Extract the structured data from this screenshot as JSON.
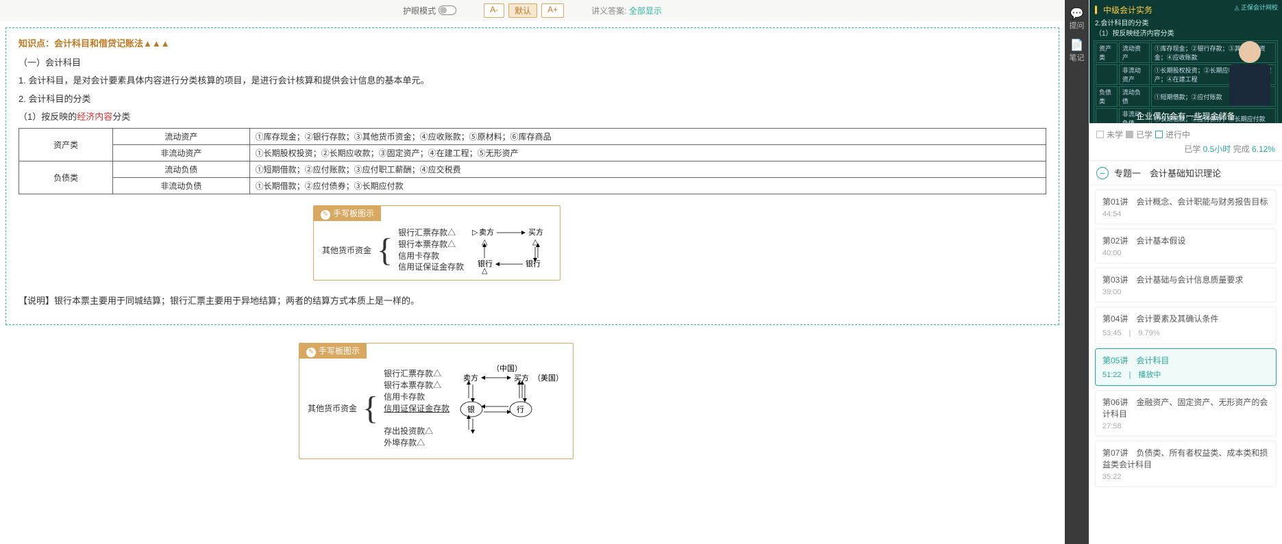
{
  "toolbar": {
    "eye_label": "护眼模式",
    "font_minus": "A-",
    "font_default": "默认",
    "font_plus": "A+",
    "ans_label": "讲义答案:",
    "ans_value": "全部显示"
  },
  "vside": {
    "ask": "提问",
    "note": "笔记"
  },
  "doc": {
    "kp_title": "知识点：会计科目和借贷记账法▲▲▲",
    "h_a": "（一）会计科目",
    "l1": "1. 会计科目，是对会计要素具体内容进行分类核算的项目，是进行会计核算和提供会计信息的基本单元。",
    "l2": "2. 会计科目的分类",
    "l3_pre": "（1）按反映的",
    "l3_red": "经济内容",
    "l3_post": "分类",
    "table": {
      "r1c1": "资产类",
      "r1c2": "流动资产",
      "r1c3": "①库存现金；②银行存款；③其他货币资金；④应收账款；⑤原材料；⑥库存商品",
      "r2c2": "非流动资产",
      "r2c3": "①长期股权投资；②长期应收款；③固定资产；④在建工程；⑤无形资产",
      "r3c1": "负债类",
      "r3c2": "流动负债",
      "r3c3": "①短期借款；②应付账款；③应付职工薪酬；④应交税费",
      "r4c2": "非流动负债",
      "r4c3": "①长期借款；②应付债券；③长期应付款"
    },
    "hw_title": "手写板图示",
    "hw1": {
      "label": "其他货币资金",
      "items": [
        "银行汇票存款△",
        "银行本票存款△",
        "信用卡存款",
        "信用证保证金存款"
      ],
      "flow": {
        "seller": "卖方",
        "buyer": "买方",
        "bank1": "银行",
        "bank2": "银行",
        "tri": "△"
      }
    },
    "note": "【说明】银行本票主要用于同城结算；银行汇票主要用于异地结算；两者的结算方式本质上是一样的。",
    "hw2": {
      "label": "其他货币资金",
      "items": [
        "银行汇票存款△",
        "银行本票存款△",
        "信用卡存款",
        "信用证保证金存款",
        "",
        "存出投资款△",
        "外埠存款△"
      ],
      "flow": {
        "cn": "（中国）",
        "us": "（美国）",
        "seller": "卖方",
        "buyer": "买方",
        "bank_l": "银",
        "bank_r": "行"
      },
      "underline_idx": 3
    }
  },
  "video": {
    "logo": "◬ 正保会计网校",
    "course": "▎中级会计实务",
    "sub1": "2.会计科目的分类",
    "sub2": "（1）按反映经济内容分类",
    "board_rows": [
      [
        "资产类",
        "流动资产",
        "①库存现金；②银行存款；③其他货币资金；④应收账款"
      ],
      [
        "",
        "非流动资产",
        "①长期股权投资；②长期应收款；③固定资产；④在建工程"
      ],
      [
        "负债类",
        "流动负债",
        "①短期借款；②应付账款"
      ],
      [
        "",
        "非流动负债",
        "①长期借款；②应付债券；③长期应付款"
      ]
    ],
    "caption": "企业偶尔会有一些现金储备"
  },
  "stats": {
    "s1": "未学",
    "s2": "已学",
    "s3": "进行中",
    "done_lbl": "已学 ",
    "done_h": "0.5小时",
    "done_lbl2": " 完成 ",
    "done_pct": "6.12%"
  },
  "topic": {
    "label": "专题一　会计基础知识理论",
    "sym": "−"
  },
  "lectures": [
    {
      "title": "第01讲　会计概念、会计职能与财务报告目标",
      "meta": "44:54"
    },
    {
      "title": "第02讲　会计基本假设",
      "meta": "40:00"
    },
    {
      "title": "第03讲　会计基础与会计信息质量要求",
      "meta": "39:00"
    },
    {
      "title": "第04讲　会计要素及其确认条件",
      "meta": "53:45　|　9.79%"
    },
    {
      "title": "第05讲　会计科目",
      "meta": "51:22　|　播放中",
      "active": true
    },
    {
      "title": "第06讲　金融资产、固定资产、无形资产的会计科目",
      "meta": "27:58"
    },
    {
      "title": "第07讲　负债类、所有者权益类、成本类和损益类会计科目",
      "meta": "35:22"
    }
  ]
}
